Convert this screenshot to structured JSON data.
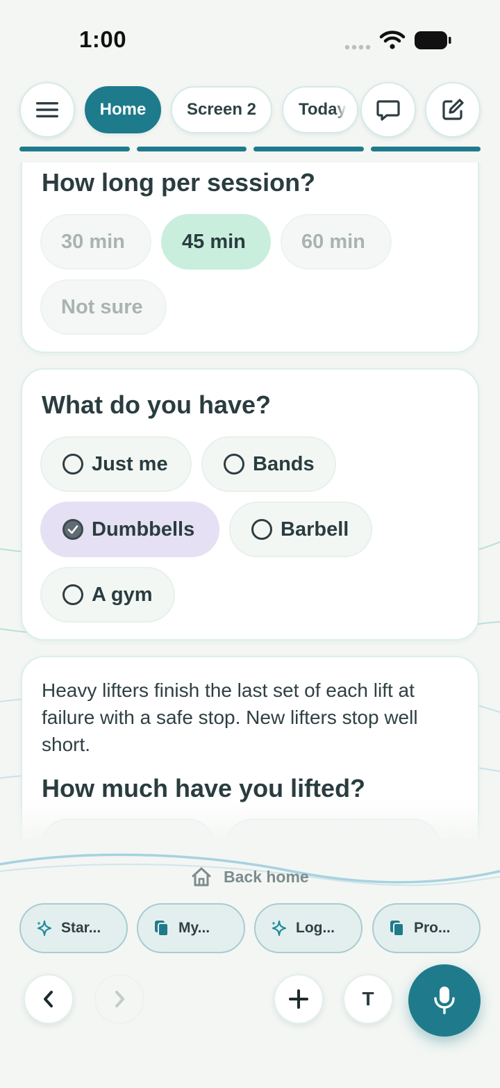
{
  "status_bar": {
    "time": "1:00"
  },
  "top_nav": {
    "menu_icon": "hamburger-icon",
    "tabs": [
      {
        "label": "Home",
        "active": true
      },
      {
        "label": "Screen 2",
        "active": false
      },
      {
        "label": "Today",
        "active": false
      }
    ],
    "chat_icon": "chat-bubble-icon",
    "edit_icon": "compose-icon",
    "progress_segments": 4
  },
  "session_card": {
    "title": "How long per session?",
    "options": [
      {
        "label": "30 min",
        "selected": false
      },
      {
        "label": "45 min",
        "selected": true
      },
      {
        "label": "60 min",
        "selected": false
      },
      {
        "label": "Not sure",
        "selected": false
      }
    ]
  },
  "equipment_card": {
    "title": "What do you have?",
    "options": [
      {
        "label": "Just me",
        "checked": false
      },
      {
        "label": "Bands",
        "checked": false
      },
      {
        "label": "Dumbbells",
        "checked": true
      },
      {
        "label": "Barbell",
        "checked": false
      },
      {
        "label": "A gym",
        "checked": false
      }
    ]
  },
  "lifting_card": {
    "body": "Heavy lifters finish the last set of each lift at failure with a safe stop. New lifters stop well short.",
    "title": "How much have you lifted?"
  },
  "bottom": {
    "back_home": "Back home",
    "quick_actions": [
      {
        "label": "Star...",
        "icon": "sparkle-icon"
      },
      {
        "label": "My...",
        "icon": "copy-icon"
      },
      {
        "label": "Log...",
        "icon": "sparkle-icon"
      },
      {
        "label": "Pro...",
        "icon": "copy-icon"
      }
    ],
    "text_button": "T",
    "colors": {
      "accent": "#1f7b8b",
      "selected_green": "#c9eedd",
      "selected_purple": "#e5e0f3"
    }
  }
}
